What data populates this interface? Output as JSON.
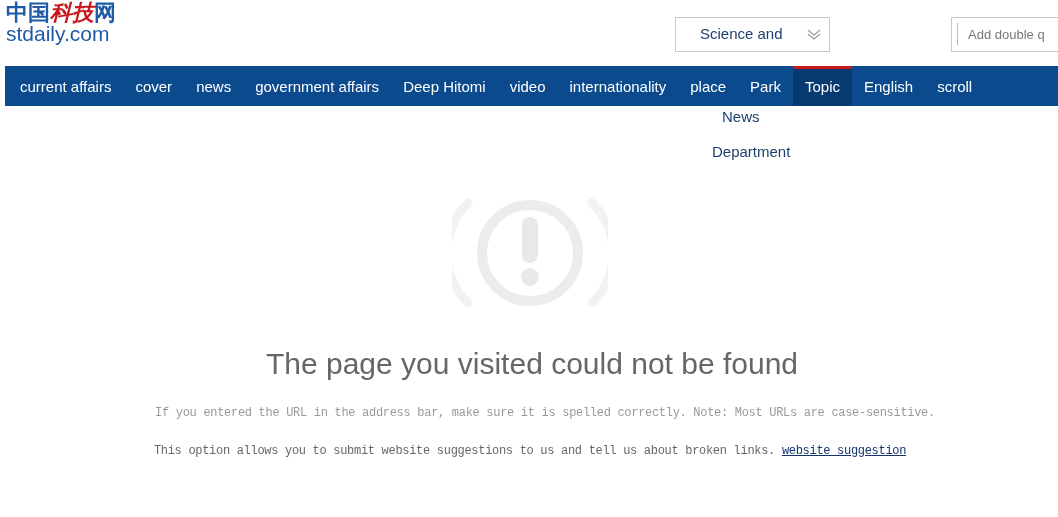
{
  "logo": {
    "chinese": "中国科技网",
    "domain": "stdaily.com"
  },
  "channel_select": {
    "value": "Science and",
    "overflow_lines": [
      "News",
      "Department"
    ]
  },
  "search": {
    "placeholder": "Add double q"
  },
  "nav": [
    {
      "label": "current affairs",
      "selected": false
    },
    {
      "label": "cover",
      "selected": false
    },
    {
      "label": "news",
      "selected": false
    },
    {
      "label": "government affairs",
      "selected": false
    },
    {
      "label": "Deep Hitomi",
      "selected": false
    },
    {
      "label": "video",
      "selected": false
    },
    {
      "label": "internationality",
      "selected": false
    },
    {
      "label": "place",
      "selected": false
    },
    {
      "label": "Park",
      "selected": false
    },
    {
      "label": "Topic",
      "selected": true
    },
    {
      "label": "English",
      "selected": false
    },
    {
      "label": "scroll",
      "selected": false
    }
  ],
  "error": {
    "title": "The page you visited could not be found",
    "hint": "If you entered the URL in the address bar, make sure it is spelled correctly. Note: Most URLs are case-sensitive.",
    "suggestion": "This option allows you to submit website suggestions to us and tell us about broken links.",
    "link": "website suggestion"
  }
}
